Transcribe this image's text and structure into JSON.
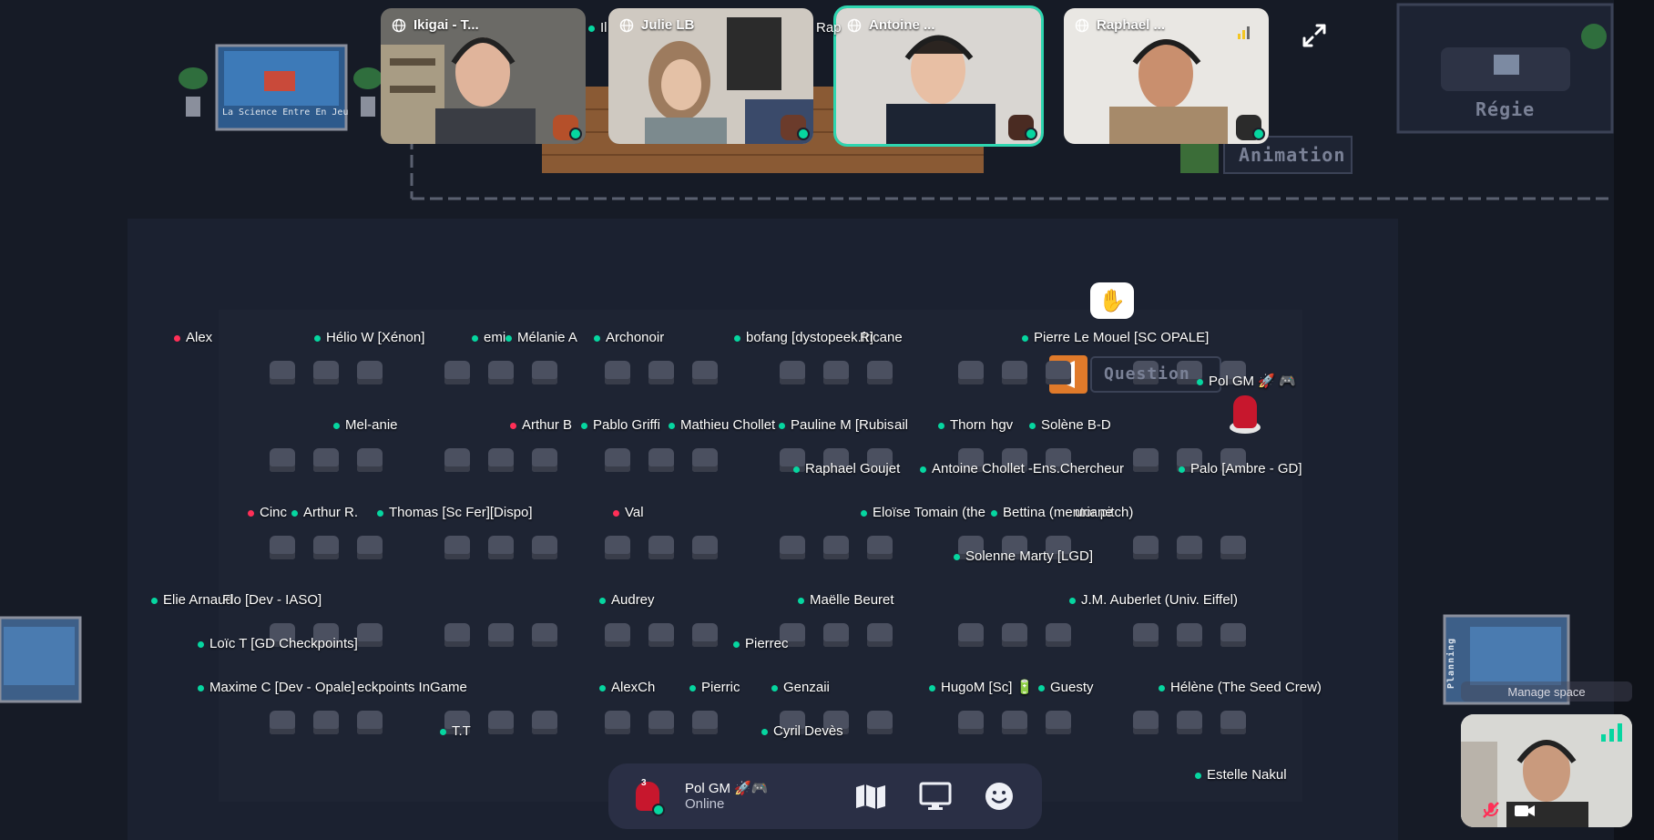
{
  "video_tiles": [
    {
      "name": "Ikigai - T..."
    },
    {
      "name": "Julie LB"
    },
    {
      "name": "Antoine ..."
    },
    {
      "name": "Raphael ..."
    }
  ],
  "partial_labels": {
    "left": "Il",
    "right": "Rap"
  },
  "map": {
    "poster_left": "La Science Entre En Jeu",
    "sign_regie": "Régie",
    "sign_animation": "Animation",
    "sign_question": "Question",
    "sign_planning": "Planning",
    "raised_hand": "✋"
  },
  "participants": [
    {
      "name": "Alex",
      "status": "red"
    },
    {
      "name": "Hélio W [Xénon]",
      "status": "green"
    },
    {
      "name": "emi",
      "status": "green"
    },
    {
      "name": "Mélanie A",
      "status": "green"
    },
    {
      "name": "Archonoir",
      "status": "green"
    },
    {
      "name": "bofang [dystopeek.fr]",
      "status": "green"
    },
    {
      "name": "Ricane",
      "status": "none"
    },
    {
      "name": "Pierre Le Mouel [SC OPALE]",
      "status": "green"
    },
    {
      "name": "Pol GM 🚀 🎮",
      "status": "green"
    },
    {
      "name": "Mel-anie",
      "status": "green"
    },
    {
      "name": "Arthur B",
      "status": "red"
    },
    {
      "name": "Pablo Griffi",
      "status": "green"
    },
    {
      "name": "Mathieu Chollet",
      "status": "green"
    },
    {
      "name": "Pauline M [Rubis",
      "status": "green"
    },
    {
      "name": "ail",
      "status": "none"
    },
    {
      "name": "Thorn",
      "status": "green"
    },
    {
      "name": "hgv",
      "status": "none"
    },
    {
      "name": "Solène B-D",
      "status": "green"
    },
    {
      "name": "Raphael Goujet",
      "status": "green"
    },
    {
      "name": "Antoine Chollet -Ens.Chercheur",
      "status": "green"
    },
    {
      "name": "Palo [Ambre - GD]",
      "status": "green"
    },
    {
      "name": "Cinc",
      "status": "red"
    },
    {
      "name": "Arthur R.",
      "status": "green"
    },
    {
      "name": "Thomas [Sc Fer][Dispo]",
      "status": "green"
    },
    {
      "name": "Val",
      "status": "red"
    },
    {
      "name": "Eloïse Tomain (the",
      "status": "green"
    },
    {
      "name": "Bettina (mentor pitch)",
      "status": "green"
    },
    {
      "name": "uriane",
      "status": "none"
    },
    {
      "name": "Solenne Marty [LGD]",
      "status": "green"
    },
    {
      "name": "Elie Arnaud",
      "status": "green"
    },
    {
      "name": "Flo [Dev - IASO]",
      "status": "none"
    },
    {
      "name": "Audrey",
      "status": "green"
    },
    {
      "name": "Maëlle Beuret",
      "status": "green"
    },
    {
      "name": "J.M. Auberlet (Univ. Eiffel)",
      "status": "green"
    },
    {
      "name": "Loïc T [GD Checkpoints]",
      "status": "green"
    },
    {
      "name": "Pierrec",
      "status": "green"
    },
    {
      "name": "Maxime C [Dev - Opale]",
      "status": "green"
    },
    {
      "name": "eckpoints InGame",
      "status": "none"
    },
    {
      "name": "AlexCh",
      "status": "green"
    },
    {
      "name": "Pierric",
      "status": "green"
    },
    {
      "name": "Genzaii",
      "status": "green"
    },
    {
      "name": "HugoM [Sc] 🔋",
      "status": "green"
    },
    {
      "name": "Guesty",
      "status": "green"
    },
    {
      "name": "Hélène (The Seed Crew)",
      "status": "green"
    },
    {
      "name": "T.T",
      "status": "green"
    },
    {
      "name": "Cyril Devès",
      "status": "green"
    },
    {
      "name": "Estelle Nakul",
      "status": "green"
    }
  ],
  "bottom_bar": {
    "user_name": "Pol GM 🚀🎮",
    "user_status": "Online",
    "notification_count": "3"
  },
  "manage_space": "Manage space",
  "colors": {
    "background": "#161b26",
    "online": "#06d6a0",
    "busy": "#ff2f57",
    "bar": "#2a2f45",
    "active_tile_border": "#2ed6b0"
  }
}
